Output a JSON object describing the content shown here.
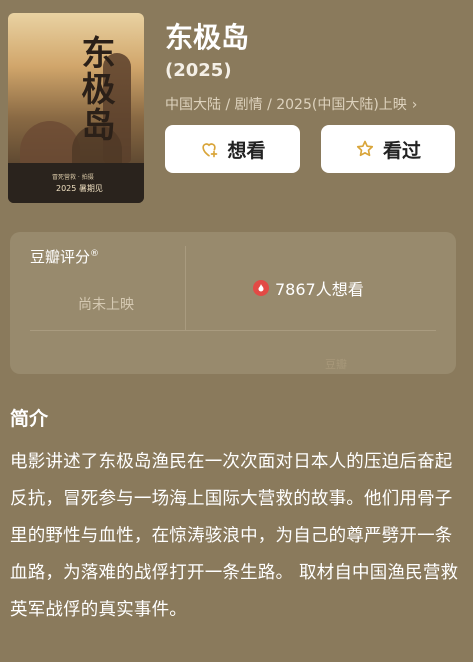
{
  "movie": {
    "title": "东极岛",
    "year": "(2025)",
    "meta": "中国大陆 / 剧情 / 2025(中国大陆)上映",
    "poster": {
      "title_art": "东极岛",
      "caption": "2025 暑期见",
      "small_text": "冒死营救 · 拍摄"
    }
  },
  "actions": {
    "want_label": "想看",
    "seen_label": "看过"
  },
  "rating": {
    "label": "豆瓣评分",
    "mark": "®",
    "status": "尚未上映",
    "wish_count_text": "7867人想看",
    "faint_text": "豆瓣"
  },
  "intro": {
    "title": "简介",
    "text": "电影讲述了东极岛渔民在一次次面对日本人的压迫后奋起反抗，冒死参与一场海上国际大营救的故事。他们用骨子里的野性与血性，在惊涛骇浪中，为自己的尊严劈开一条血路，为落难的战俘打开一条生路。 取材自中国渔民营救英军战俘的真实事件。"
  },
  "icons": {
    "want": "heart-plus-icon",
    "seen": "star-outline-icon",
    "wish": "flame-icon",
    "chevron": "chevron-right-icon"
  }
}
